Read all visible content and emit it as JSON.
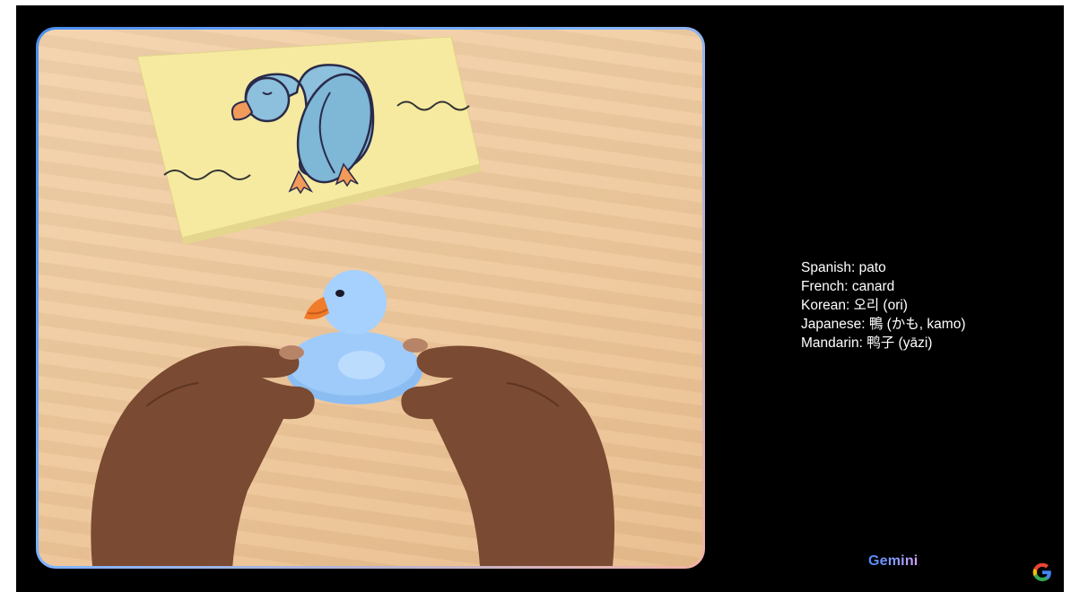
{
  "captions": [
    "Spanish: pato",
    "French: canard",
    "Korean: 오리 (ori)",
    "Japanese: 鴨 (かも, kamo)",
    "Mandarin: 鸭子 (yāzi)"
  ],
  "brand": {
    "gemini_label": "Gemini",
    "google_logo": "google-g-icon"
  },
  "colors": {
    "background": "#000000",
    "frame_gradient_start": "#4a8ef0",
    "frame_gradient_end": "#f3b2a4",
    "caption_text": "#ffffff"
  }
}
